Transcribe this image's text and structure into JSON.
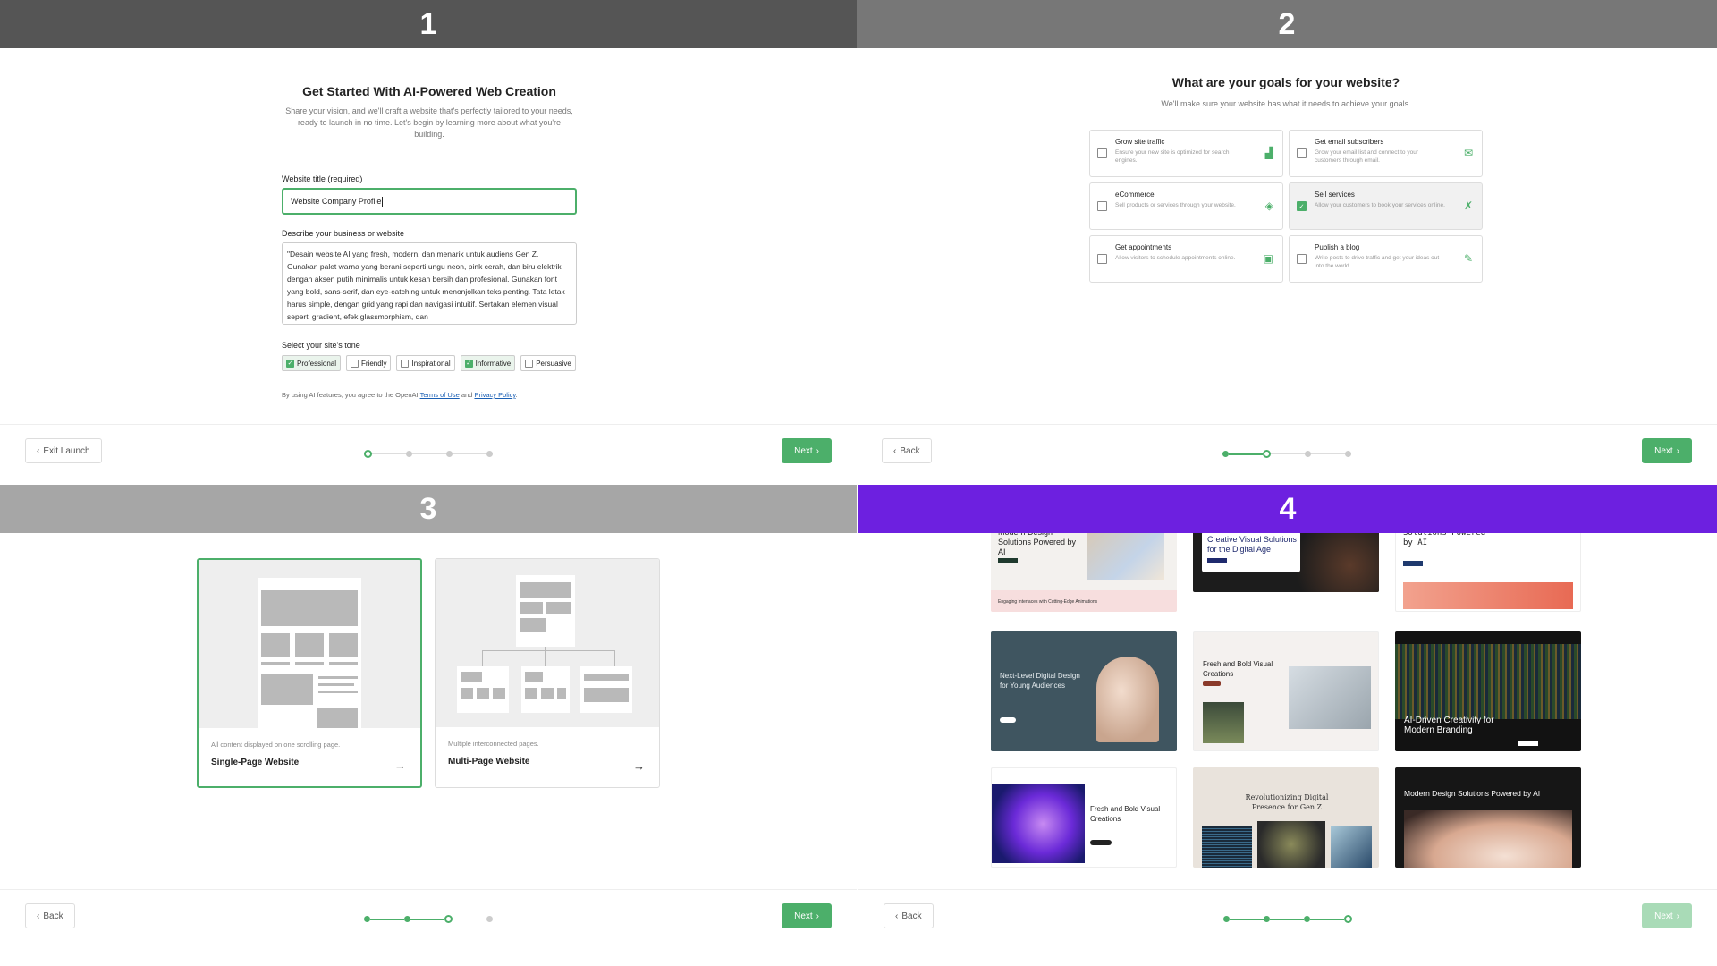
{
  "panels": {
    "p1": {
      "number": "1",
      "title": "Get Started With AI-Powered Web Creation",
      "subtitle": "Share your vision, and we'll craft a website that's perfectly tailored to your needs, ready to launch in no time. Let's begin by learning more about what you're building.",
      "title_label": "Website title (required)",
      "title_value": "Website Company Profile",
      "describe_label": "Describe your business or website",
      "describe_value": "\"Desain website AI yang fresh, modern, dan menarik untuk audiens Gen Z. Gunakan palet warna yang berani seperti ungu neon, pink cerah, dan biru elektrik dengan aksen putih minimalis untuk kesan bersih dan profesional. Gunakan font yang bold, sans-serif, dan eye-catching untuk menonjolkan teks penting. Tata letak harus simple, dengan grid yang rapi dan navigasi intuitif. Sertakan elemen visual seperti gradient, efek glassmorphism, dan",
      "tone_label": "Select your site's tone",
      "tones": [
        {
          "label": "Professional",
          "checked": true
        },
        {
          "label": "Friendly",
          "checked": false
        },
        {
          "label": "Inspirational",
          "checked": false
        },
        {
          "label": "Informative",
          "checked": true
        },
        {
          "label": "Persuasive",
          "checked": false
        }
      ],
      "legal_prefix": "By using AI features, you agree to the OpenAI",
      "legal_terms": "Terms of Use",
      "legal_and": "and",
      "legal_privacy": "Privacy Policy",
      "legal_suffix": ".",
      "back_label": "Exit Launch",
      "next_label": "Next"
    },
    "p2": {
      "number": "2",
      "title": "What are your goals for your website?",
      "subtitle": "We'll make sure your website has what it needs to achieve your goals.",
      "goals": [
        {
          "title": "Grow site traffic",
          "desc": "Ensure your new site is optimized for search engines.",
          "icon": "chart-icon",
          "checked": false
        },
        {
          "title": "Get email subscribers",
          "desc": "Grow your email list and connect to your customers through email.",
          "icon": "envelope-icon",
          "checked": false
        },
        {
          "title": "eCommerce",
          "desc": "Sell products or services through your website.",
          "icon": "tag-icon",
          "checked": false
        },
        {
          "title": "Sell services",
          "desc": "Allow your customers to book your services online.",
          "icon": "tools-icon",
          "checked": true
        },
        {
          "title": "Get appointments",
          "desc": "Allow visitors to schedule appointments online.",
          "icon": "calendar-icon",
          "checked": false
        },
        {
          "title": "Publish a blog",
          "desc": "Write posts to drive traffic and get your ideas out into the world.",
          "icon": "pencil-icon",
          "checked": false
        }
      ],
      "back_label": "Back",
      "next_label": "Next"
    },
    "p3": {
      "number": "3",
      "cards": [
        {
          "desc": "All content displayed on one scrolling page.",
          "title": "Single-Page Website",
          "selected": true
        },
        {
          "desc": "Multiple interconnected pages.",
          "title": "Multi-Page Website",
          "selected": false
        }
      ],
      "back_label": "Back",
      "next_label": "Next"
    },
    "p4": {
      "number": "4",
      "thumb_texts": [
        "Modern Design Solutions Powered by AI",
        "Creative Visual Solutions for the Digital Age",
        "Solutions Powered by AI",
        "Engaging Interfaces with Cutting-Edge Animations",
        "Next-Level Digital Design for Young Audiences",
        "Fresh and Bold Visual Creations",
        "AI-Driven Creativity for Modern Branding",
        "Fresh and Bold Visual Creations",
        "Revolutionizing Digital Presence for Gen Z",
        "Modern Design Solutions Powered by AI"
      ],
      "back_label": "Back",
      "next_label": "Next"
    }
  },
  "colors": {
    "accent_green": "#4caf6a",
    "banner4_purple": "#6d20e0"
  }
}
